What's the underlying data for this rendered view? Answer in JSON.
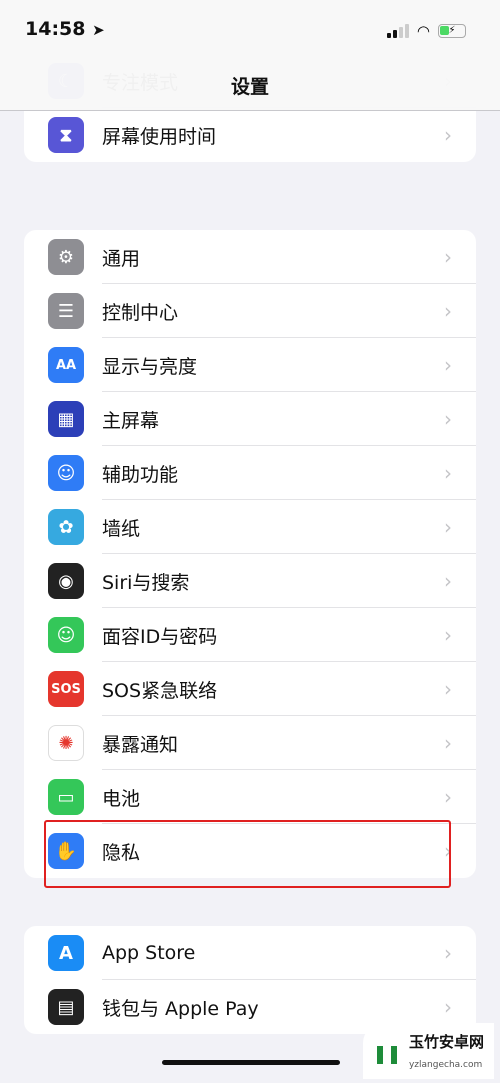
{
  "status": {
    "time": "14:58",
    "location_icon": "location-arrow-icon",
    "battery": "charging"
  },
  "nav": {
    "title": "设置"
  },
  "groups": [
    [
      {
        "label": "专注模式",
        "icon": "moon-icon",
        "color": "#5856d6",
        "glyph": "☾"
      },
      {
        "label": "屏幕使用时间",
        "icon": "hourglass-icon",
        "color": "#5856d6",
        "glyph": "⧗"
      }
    ],
    [
      {
        "label": "通用",
        "icon": "gear-icon",
        "color": "#8e8e93",
        "glyph": "⚙"
      },
      {
        "label": "控制中心",
        "icon": "toggles-icon",
        "color": "#8e8e93",
        "glyph": "☰"
      },
      {
        "label": "显示与亮度",
        "icon": "text-size-icon",
        "color": "#2f7cf6",
        "glyph": "AA"
      },
      {
        "label": "主屏幕",
        "icon": "home-grid-icon",
        "color": "#2c3fb8",
        "glyph": "▦"
      },
      {
        "label": "辅助功能",
        "icon": "accessibility-icon",
        "color": "#2f7cf6",
        "glyph": "☺"
      },
      {
        "label": "墙纸",
        "icon": "flower-icon",
        "color": "#36a9e0",
        "glyph": "✿"
      },
      {
        "label": "Siri与搜索",
        "icon": "siri-icon",
        "color": "#222222",
        "glyph": "◉"
      },
      {
        "label": "面容ID与密码",
        "icon": "face-id-icon",
        "color": "#34c759",
        "glyph": "☺"
      },
      {
        "label": "SOS紧急联络",
        "icon": "sos-icon",
        "color": "#e5362d",
        "glyph": "SOS"
      },
      {
        "label": "暴露通知",
        "icon": "exposure-icon",
        "color": "#ffffff",
        "glyph": "✺"
      },
      {
        "label": "电池",
        "icon": "battery-icon",
        "color": "#34c759",
        "glyph": "▭"
      },
      {
        "label": "隐私",
        "icon": "hand-icon",
        "color": "#2f7cf6",
        "glyph": "✋"
      }
    ],
    [
      {
        "label": "App Store",
        "icon": "app-store-icon",
        "color": "#1a8cf5",
        "glyph": "A"
      },
      {
        "label": "钱包与 Apple Pay",
        "icon": "wallet-icon",
        "color": "#222222",
        "glyph": "▤"
      }
    ]
  ],
  "watermark": {
    "name": "玉竹安卓网",
    "url": "yzlangecha.com"
  }
}
